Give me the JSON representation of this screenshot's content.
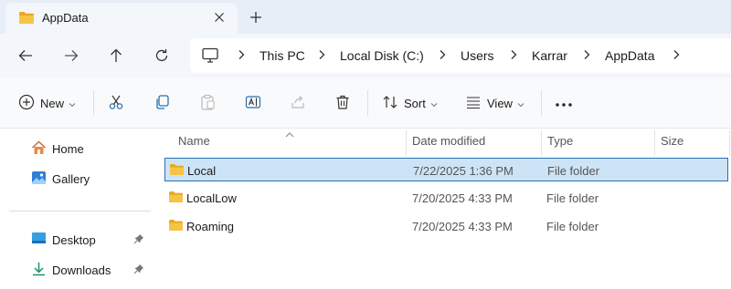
{
  "tab": {
    "title": "AppData",
    "close_icon": "close-icon",
    "new_tab_icon": "plus-icon"
  },
  "nav": {
    "back_icon": "arrow-left-icon",
    "forward_icon": "arrow-right-icon",
    "up_icon": "arrow-up-icon",
    "refresh_icon": "refresh-icon",
    "breadcrumbs": [
      "This PC",
      "Local Disk (C:)",
      "Users",
      "Karrar",
      "AppData"
    ]
  },
  "toolbar": {
    "new_label": "New",
    "sort_label": "Sort",
    "view_label": "View",
    "icons": [
      "plus-circle-icon",
      "cut-icon",
      "copy-icon",
      "paste-icon",
      "rename-icon",
      "share-icon",
      "trash-icon",
      "sort-icon",
      "view-icon",
      "more-icon"
    ]
  },
  "sidebar": {
    "items": [
      {
        "label": "Home",
        "icon": "home-icon",
        "pinned": false
      },
      {
        "label": "Gallery",
        "icon": "gallery-icon",
        "pinned": false
      },
      {
        "label": "Desktop",
        "icon": "desktop-icon",
        "pinned": true
      },
      {
        "label": "Downloads",
        "icon": "download-icon",
        "pinned": true
      }
    ]
  },
  "columns": {
    "name": "Name",
    "date": "Date modified",
    "type": "Type",
    "size": "Size"
  },
  "files": [
    {
      "name": "Local",
      "date": "7/22/2025 1:36 PM",
      "type": "File folder",
      "selected": true
    },
    {
      "name": "LocalLow",
      "date": "7/20/2025 4:33 PM",
      "type": "File folder",
      "selected": false
    },
    {
      "name": "Roaming",
      "date": "7/20/2025 4:33 PM",
      "type": "File folder",
      "selected": false
    }
  ],
  "colors": {
    "accent": "#2a6fb0",
    "selection_bg": "#cde4f7",
    "folder_yellow": "#f6c445",
    "titlebar_bg": "#e8eef7"
  }
}
